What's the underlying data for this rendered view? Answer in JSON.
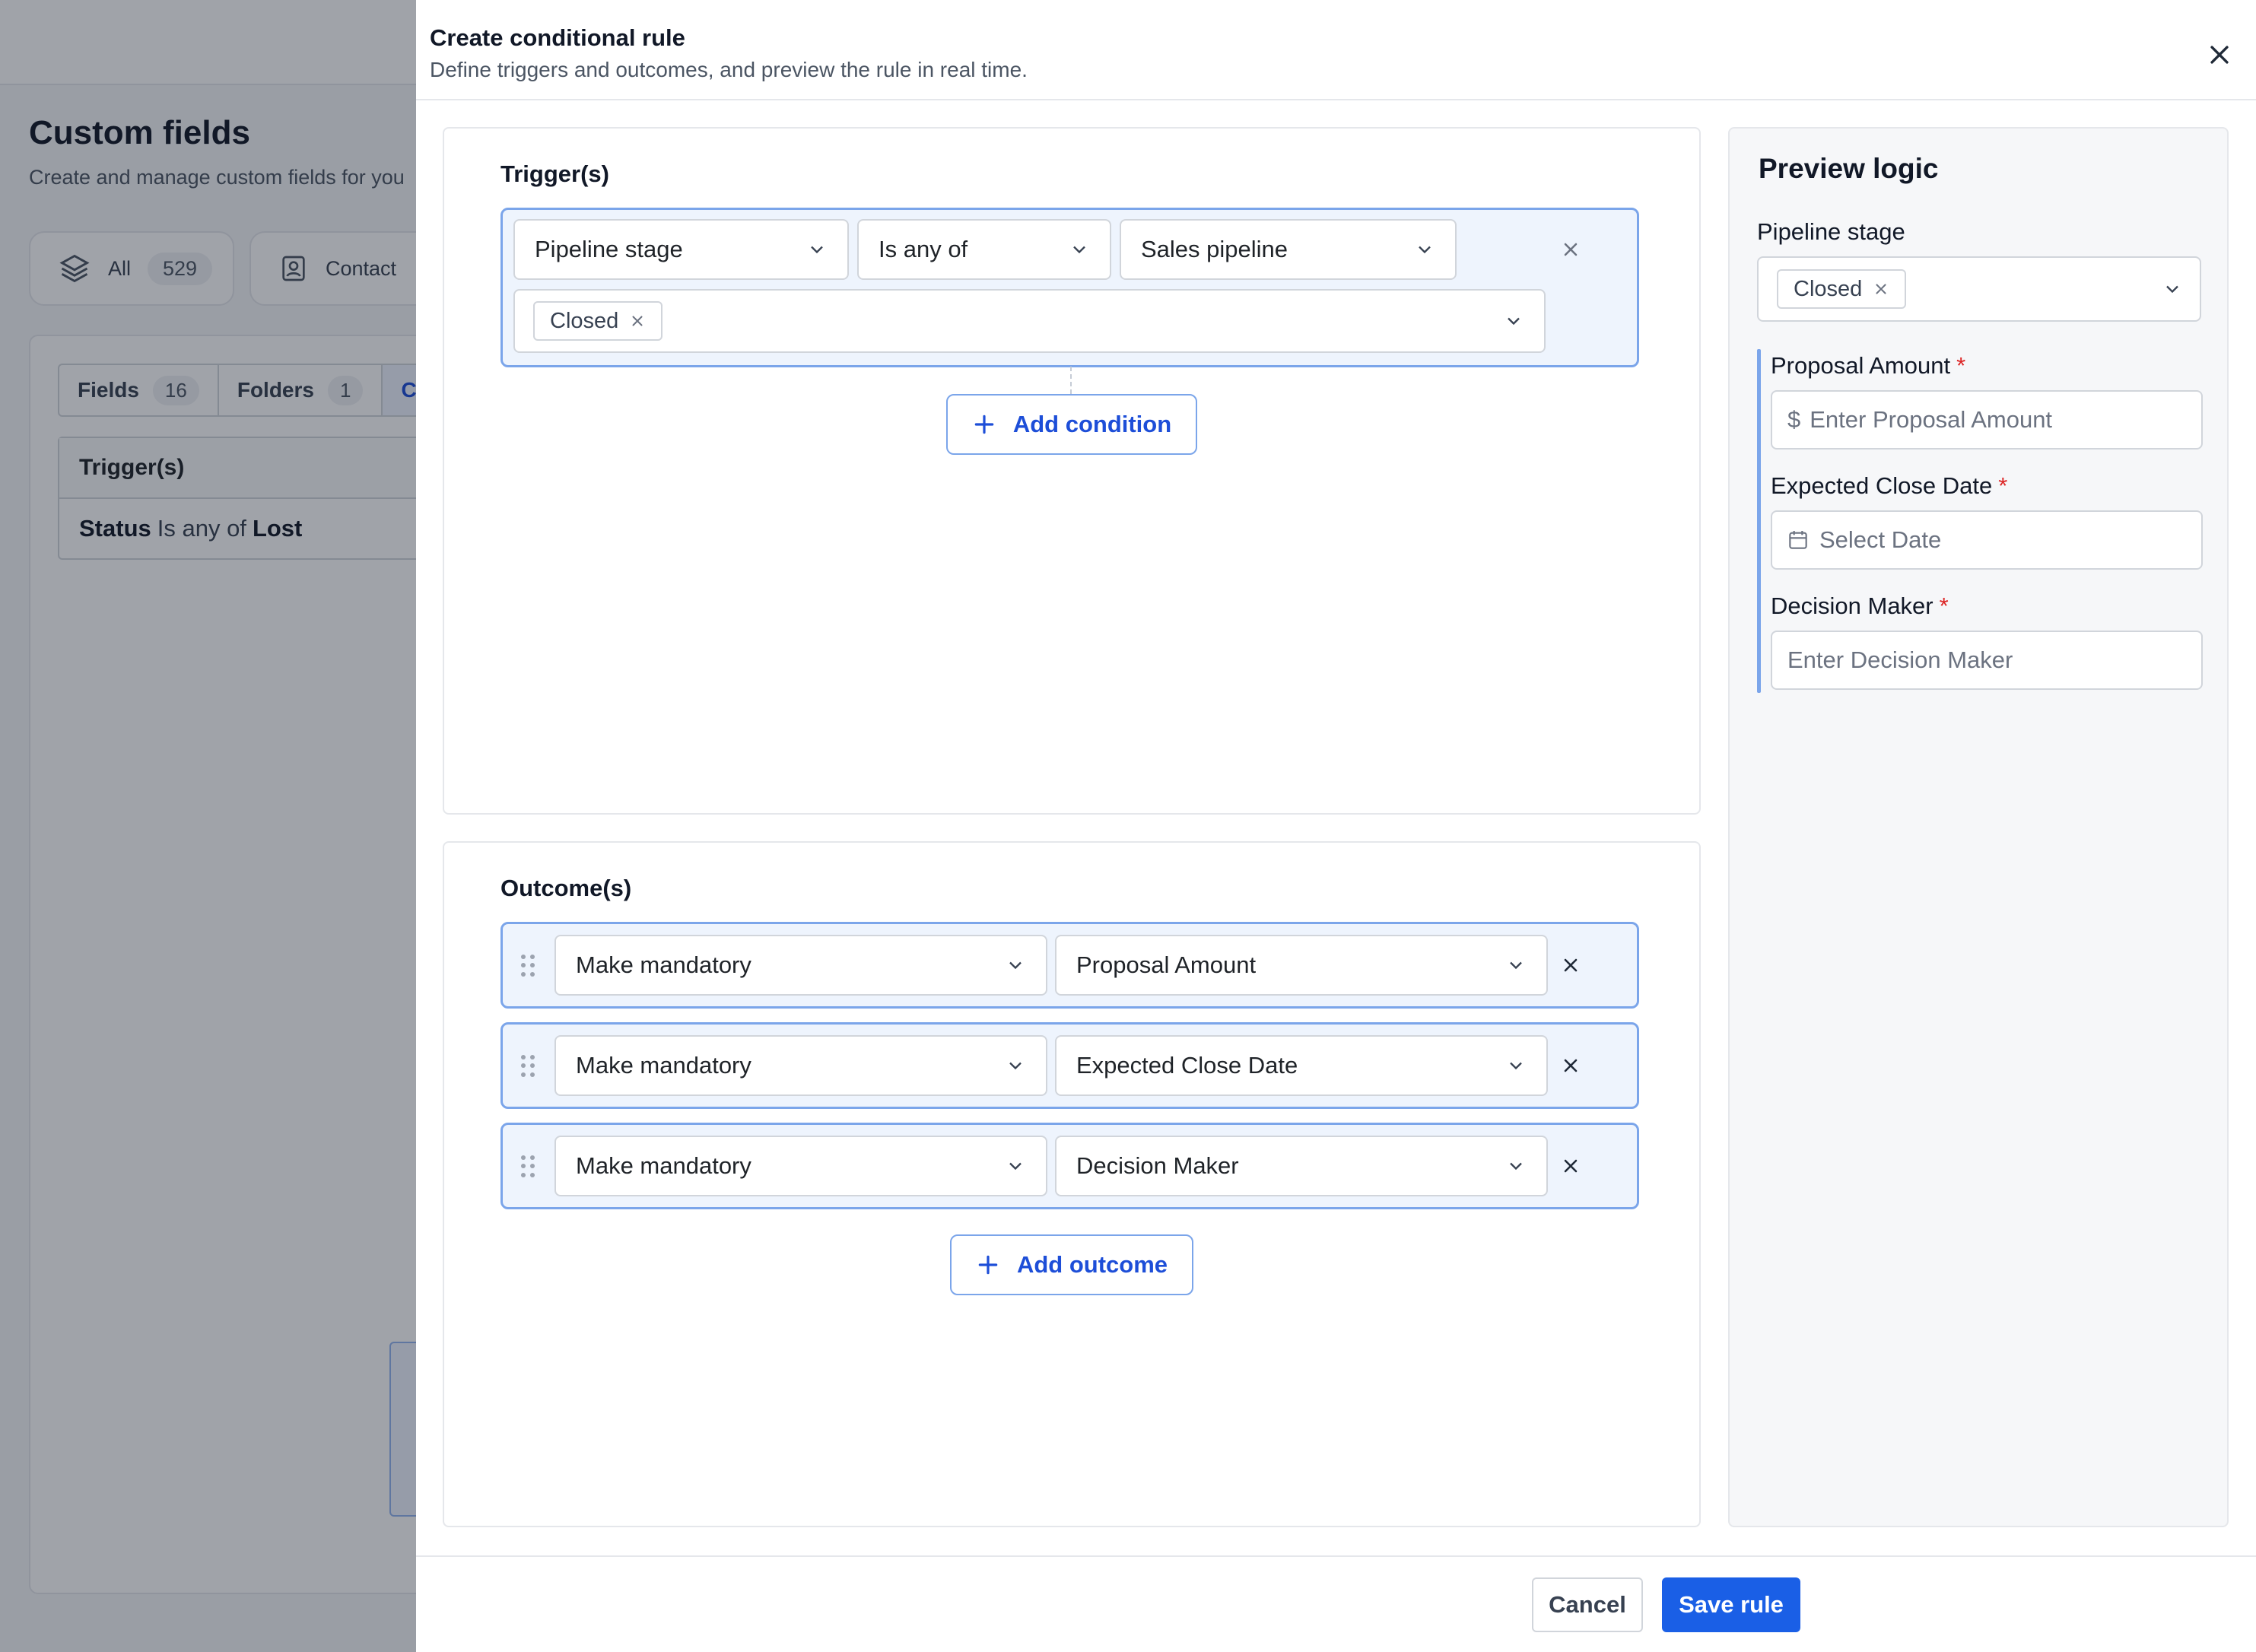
{
  "background": {
    "title": "Custom fields",
    "subtitle": "Create and manage custom fields for you",
    "cards": [
      {
        "label": "All",
        "count": "529",
        "icon": "layers-icon"
      },
      {
        "label": "Contact",
        "icon": "contact-book-icon"
      }
    ],
    "tabs": [
      {
        "label": "Fields",
        "count": "16"
      },
      {
        "label": "Folders",
        "count": "1"
      },
      {
        "label": "Co"
      }
    ],
    "table": {
      "header": "Trigger(s)",
      "row": {
        "field": "Status",
        "operator": "Is any of",
        "value": "Lost"
      }
    }
  },
  "drawer": {
    "title": "Create conditional rule",
    "subtitle": "Define triggers and outcomes, and preview the rule in real time.",
    "triggers": {
      "label": "Trigger(s)",
      "field": "Pipeline stage",
      "operator": "Is any of",
      "pipeline": "Sales pipeline",
      "chips": [
        "Closed"
      ],
      "add_label": "Add condition"
    },
    "outcomes": {
      "label": "Outcome(s)",
      "items": [
        {
          "action": "Make mandatory",
          "field": "Proposal Amount"
        },
        {
          "action": "Make mandatory",
          "field": "Expected Close Date"
        },
        {
          "action": "Make mandatory",
          "field": "Decision Maker"
        }
      ],
      "add_label": "Add outcome"
    },
    "preview": {
      "title": "Preview logic",
      "stage_label": "Pipeline stage",
      "stage_chip": "Closed",
      "fields": [
        {
          "label": "Proposal Amount",
          "required": "*",
          "prefix": "$",
          "placeholder": "Enter Proposal Amount"
        },
        {
          "label": "Expected Close Date",
          "required": "*",
          "placeholder": "Select Date",
          "icon": "calendar-icon"
        },
        {
          "label": "Decision Maker",
          "required": "*",
          "placeholder": "Enter Decision Maker"
        }
      ]
    },
    "footer": {
      "cancel": "Cancel",
      "save": "Save rule"
    }
  },
  "colors": {
    "accent": "#1a5fe6",
    "accent_border": "#7ba5ea",
    "accent_bg": "#eef4fd",
    "required": "#dc2626"
  }
}
